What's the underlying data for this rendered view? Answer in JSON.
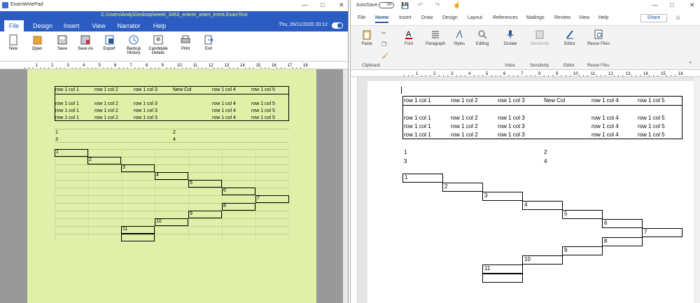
{
  "ewp": {
    "app_title": "ExamWritePad",
    "file_path": "C:\\Users\\Andy\\Desktop\\eeeet_3453_erterte_ertert_ertret.ExamText",
    "date": "Thu, 26/11/2020 20:12",
    "tabs": [
      "File",
      "Design",
      "Insert",
      "View",
      "Narrator",
      "Help"
    ],
    "active_tab": "File",
    "buttons": [
      {
        "label": "New",
        "icon": "new-icon"
      },
      {
        "label": "Open",
        "icon": "open-icon"
      },
      {
        "label": "Save",
        "icon": "save-icon"
      },
      {
        "label": "Save As",
        "icon": "save-as-icon"
      },
      {
        "label": "Export",
        "icon": "export-icon"
      },
      {
        "label": "Backup History",
        "icon": "backup-history-icon"
      },
      {
        "label": "Candidate Details",
        "icon": "candidate-details-icon"
      },
      {
        "label": "Print",
        "icon": "print-icon"
      },
      {
        "label": "Exit",
        "icon": "exit-icon"
      }
    ],
    "ruler_numbers": [
      "1",
      "2",
      "3",
      "4",
      "5",
      "6",
      "7",
      "8",
      "9",
      "10",
      "11",
      "12",
      "13",
      "14",
      "15",
      "16",
      "17",
      "18"
    ],
    "colors": {
      "header": "#2a5cc2",
      "page": "#e0f0a8",
      "path_text": "#ffff66"
    }
  },
  "word": {
    "autosave_label": "AutoSave",
    "autosave_state": "Off",
    "tabs": [
      "File",
      "Home",
      "Insert",
      "Draw",
      "Design",
      "Layout",
      "References",
      "Mailings",
      "Review",
      "View",
      "Help"
    ],
    "active_tab": "Home",
    "share_label": "Share",
    "buttons": [
      {
        "label": "Paste",
        "icon": "paste-icon"
      },
      {
        "label": "Font",
        "icon": "font-icon"
      },
      {
        "label": "Paragraph",
        "icon": "paragraph-icon"
      },
      {
        "label": "Styles",
        "icon": "styles-icon"
      },
      {
        "label": "Editing",
        "icon": "editing-icon"
      },
      {
        "label": "Dictate",
        "icon": "dictate-icon"
      },
      {
        "label": "Sensitivity",
        "icon": "sensitivity-icon"
      },
      {
        "label": "Editor",
        "icon": "editor-icon"
      },
      {
        "label": "Reuse Files",
        "icon": "reuse-files-icon"
      }
    ],
    "groups": [
      "Clipboard",
      "Voice",
      "Sensitivity",
      "Editor",
      "Reuse Files"
    ],
    "ruler_numbers": [
      "1",
      "2",
      "3",
      "4",
      "5",
      "6",
      "7",
      "8",
      "9",
      "10",
      "11",
      "12",
      "13",
      "14",
      "15",
      "16"
    ],
    "colors": {
      "accent": "#2b579a"
    }
  },
  "document": {
    "table1": {
      "header": [
        "row 1 col 1",
        "row 1 col 2",
        "row 1 col 3",
        "New Col",
        "row 1 col 4",
        "row 1 col 5"
      ],
      "rows": [
        [
          "row 1 col 1",
          "row 1 col 2",
          "row 1 col 3",
          "",
          "row 1 col 4",
          "row 1 col 5"
        ],
        [
          "row 1 col 1",
          "row 1 col 2",
          "row 1 col 3",
          "",
          "row 1 col 4",
          "row 1 col 5"
        ],
        [
          "row 1 col 1",
          "row 1 col 2",
          "row 1 col 3",
          "",
          "row 1 col 4",
          "row 1 col 5"
        ]
      ]
    },
    "table2": [
      [
        "1",
        "2"
      ],
      [
        "3",
        "4"
      ]
    ],
    "steps": [
      "1",
      "2",
      "3",
      "4",
      "5",
      "6",
      "7",
      "8",
      "9",
      "10",
      "11"
    ]
  }
}
